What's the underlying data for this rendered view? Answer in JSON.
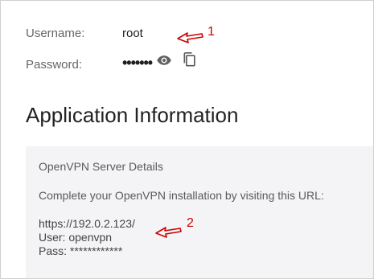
{
  "credentials": {
    "username_label": "Username:",
    "username_value": "root",
    "password_label": "Password:",
    "password_masked": "•••••••",
    "show_password_icon": "eye-icon",
    "copy_icon": "copy-icon"
  },
  "annotations": {
    "marker_1": "1",
    "marker_2": "2",
    "color": "#cc0000"
  },
  "section": {
    "title": "Application Information"
  },
  "panel": {
    "heading": "OpenVPN Server Details",
    "instruction": "Complete your OpenVPN installation by visiting this URL:",
    "url": "https://192.0.2.123/",
    "user_line": "User: openvpn",
    "pass_line": "Pass: ************"
  }
}
